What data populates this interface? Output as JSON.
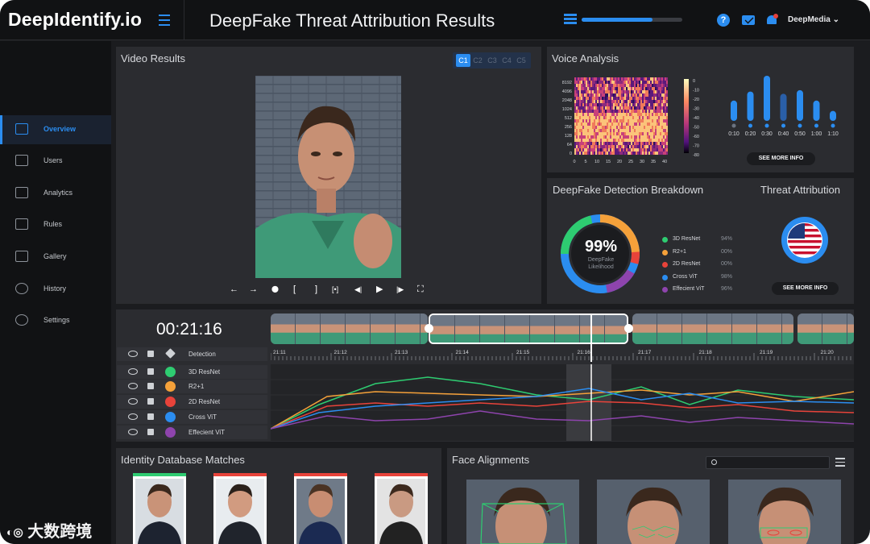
{
  "header": {
    "brand": "DeepIdentify.io",
    "title": "DeepFake Threat Attribution Results",
    "progress": 0.7,
    "help_glyph": "?",
    "user": "DeepMedia ⌄"
  },
  "sidebar": {
    "items": [
      {
        "label": "Overview",
        "icon": "home-icon",
        "active": true
      },
      {
        "label": "Users",
        "icon": "users-icon"
      },
      {
        "label": "Analytics",
        "icon": "chart-icon"
      },
      {
        "label": "Rules",
        "icon": "list-icon"
      },
      {
        "label": "Gallery",
        "icon": "gallery-icon"
      },
      {
        "label": "History",
        "icon": "history-icon"
      },
      {
        "label": "Settings",
        "icon": "gear-icon"
      }
    ]
  },
  "video_results": {
    "title": "Video Results",
    "cameras": [
      "C1",
      "C2",
      "C3",
      "C4",
      "C5"
    ],
    "active_camera": "C1",
    "controls": [
      "←",
      "→",
      "⬤",
      "[",
      "]",
      "[•]",
      "◀|",
      "▶",
      "|▶",
      "⛶"
    ]
  },
  "voice_analysis": {
    "title": "Voice Analysis",
    "spectrogram_y_ticks": [
      "8192",
      "4096",
      "2048",
      "1024",
      "512",
      "256",
      "128",
      "64",
      "0"
    ],
    "spectrogram_x_ticks": [
      "0",
      "5",
      "10",
      "15",
      "20",
      "25",
      "30",
      "35",
      "40"
    ],
    "colorbar_ticks": [
      "0",
      "-10",
      "-20",
      "-30",
      "-40",
      "-50",
      "-60",
      "-70",
      "-80"
    ],
    "bar_labels": [
      "0:10",
      "0:20",
      "0:30",
      "0:40",
      "0:50",
      "1:00",
      "1:10"
    ],
    "bar_levels": [
      0.45,
      0.65,
      1.0,
      0.6,
      0.68,
      0.45,
      0.22
    ],
    "see_more": "SEE MORE INFO"
  },
  "breakdown": {
    "title": "DeepFake Detection Breakdown",
    "likelihood": "99%",
    "likelihood_caption_1": "DeepFake",
    "likelihood_caption_2": "Likelihood",
    "models": [
      {
        "name": "3D ResNet",
        "value": "94%",
        "color": "#2ecc71"
      },
      {
        "name": "R2+1",
        "value": "00%",
        "color": "#f5a13a"
      },
      {
        "name": "2D ResNet",
        "value": "00%",
        "color": "#e8433a"
      },
      {
        "name": "Cross ViT",
        "value": "98%",
        "color": "#2b8df0"
      },
      {
        "name": "Effecient ViT",
        "value": "96%",
        "color": "#8e44ad"
      }
    ]
  },
  "attribution": {
    "title": "Threat Attribution",
    "see_more": "SEE MORE INFO"
  },
  "timeline": {
    "timecode": "00:21:16",
    "header_label": "Detection",
    "time_ticks": [
      "21:11",
      "21:12",
      "21:13",
      "21:14",
      "21:15",
      "21:16",
      "21:17",
      "21:18",
      "21:19",
      "21:20"
    ],
    "tracks": [
      {
        "name": "3D ResNet",
        "color": "#2ecc71"
      },
      {
        "name": "R2+1",
        "color": "#f5a13a"
      },
      {
        "name": "2D ResNet",
        "color": "#e8433a"
      },
      {
        "name": "Cross ViT",
        "color": "#2b8df0"
      },
      {
        "name": "Effecient ViT",
        "color": "#8e44ad"
      }
    ]
  },
  "identity_matches": {
    "title": "Identity Database Matches"
  },
  "face_alignments": {
    "title": "Face Alignments"
  },
  "watermark": "大数跨境"
}
